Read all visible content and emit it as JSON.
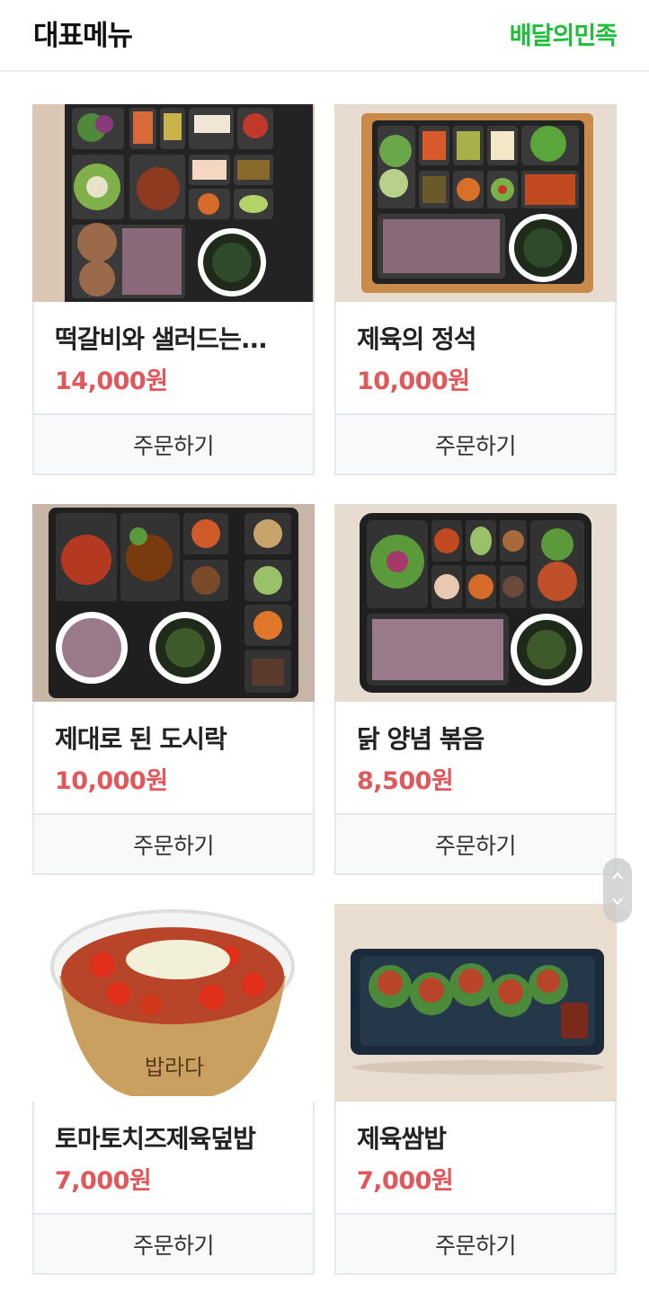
{
  "header": {
    "title": "대표메뉴",
    "brand": "배달의민족",
    "brand_color": "#1fbe3a"
  },
  "menu": [
    {
      "name": "떡갈비와 샐러드는...",
      "price": "14,000원",
      "order_label": "주문하기",
      "image": "dosirak-tteokgalbi-salad"
    },
    {
      "name": "제육의 정석",
      "price": "10,000원",
      "order_label": "주문하기",
      "image": "dosirak-jeyuk"
    },
    {
      "name": "제대로 된 도시락",
      "price": "10,000원",
      "order_label": "주문하기",
      "image": "dosirak-proper"
    },
    {
      "name": "닭 양념 볶음",
      "price": "8,500원",
      "order_label": "주문하기",
      "image": "dosirak-chicken"
    },
    {
      "name": "토마토치즈제육덮밥",
      "price": "7,000원",
      "order_label": "주문하기",
      "image": "bowl-tomato-cheese-jeyuk"
    },
    {
      "name": "제육쌈밥",
      "price": "7,000원",
      "order_label": "주문하기",
      "image": "jeyuk-ssambap"
    }
  ],
  "colors": {
    "price": "#e0585b",
    "border": "#e6e8eb",
    "button_bg": "#f8f9fa"
  },
  "icons": {
    "scroll_up": "chevron-up-icon",
    "scroll_down": "chevron-down-icon"
  }
}
